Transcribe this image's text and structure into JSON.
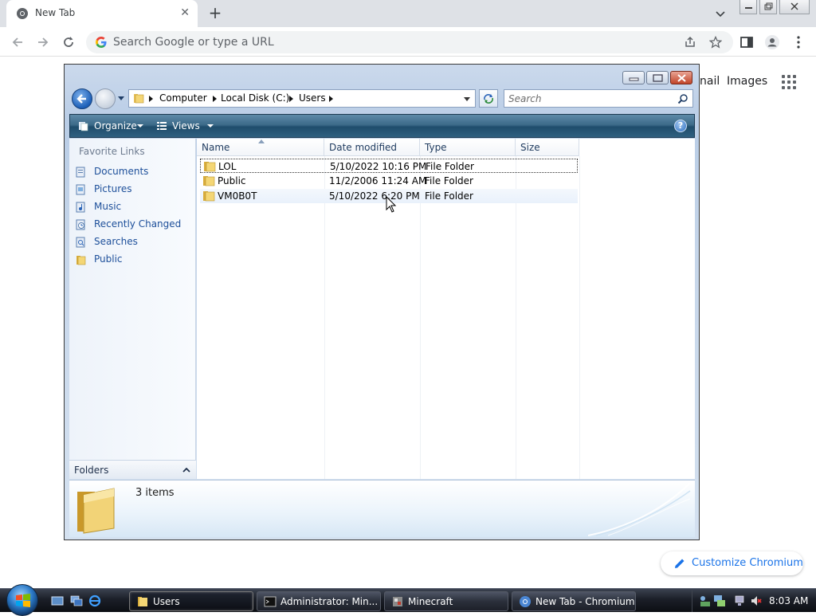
{
  "browser": {
    "tab_title": "New Tab",
    "tab_close": "✕",
    "new_tab": "+",
    "omnibox_placeholder": "Search Google or type a URL",
    "google_links": {
      "gmail_partial": "nail",
      "images": "Images"
    },
    "customize_label": "Customize Chromium"
  },
  "explorer": {
    "breadcrumb": [
      "Computer",
      "Local Disk (C:)",
      "Users"
    ],
    "search_placeholder": "Search",
    "toolbar": {
      "organize": "Organize",
      "views": "Views",
      "help": "?"
    },
    "nav": {
      "title": "Favorite Links",
      "items": [
        {
          "label": "Documents",
          "icon": "documents-icon"
        },
        {
          "label": "Pictures",
          "icon": "pictures-icon"
        },
        {
          "label": "Music",
          "icon": "music-icon"
        },
        {
          "label": "Recently Changed",
          "icon": "recently-changed-icon"
        },
        {
          "label": "Searches",
          "icon": "searches-icon"
        },
        {
          "label": "Public",
          "icon": "folder-icon"
        }
      ],
      "folders_label": "Folders"
    },
    "columns": [
      "Name",
      "Date modified",
      "Type",
      "Size"
    ],
    "files": [
      {
        "name": "LOL",
        "date": "5/10/2022 10:16 PM",
        "type": "File Folder",
        "size": ""
      },
      {
        "name": "Public",
        "date": "11/2/2006 11:24 AM",
        "type": "File Folder",
        "size": ""
      },
      {
        "name": "VM0B0T",
        "date": "5/10/2022 6:20 PM",
        "type": "File Folder",
        "size": ""
      }
    ],
    "item_count": "3 items"
  },
  "taskbar": {
    "buttons": [
      {
        "label": "Users",
        "icon": "folder-icon"
      },
      {
        "label": "Administrator:  Min...",
        "icon": "cmd-icon"
      },
      {
        "label": "Minecraft",
        "icon": "minecraft-icon"
      },
      {
        "label": "New Tab - Chromium",
        "icon": "chromium-icon"
      }
    ],
    "clock": "8:03 AM"
  },
  "colors": {
    "chrome_tabbar": "#dee1e6",
    "explorer_link": "#1d4f9a",
    "customize_accent": "#1a73e8",
    "taskbar": "#1b1f28"
  }
}
